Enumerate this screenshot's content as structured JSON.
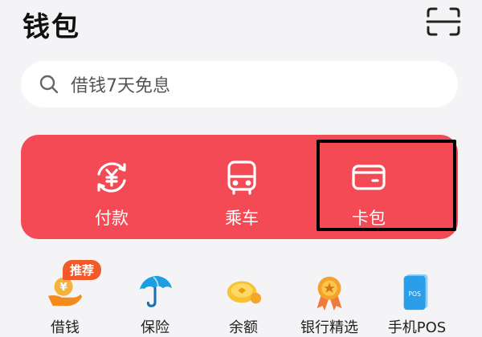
{
  "header": {
    "title": "钱包"
  },
  "search": {
    "text": "借钱7天免息"
  },
  "actions": [
    {
      "label": "付款",
      "icon": "payment-cycle-icon"
    },
    {
      "label": "乘车",
      "icon": "bus-icon"
    },
    {
      "label": "卡包",
      "icon": "card-wallet-icon"
    }
  ],
  "services": [
    {
      "label": "借钱",
      "icon": "yuan-hand-icon",
      "badge": "推荐"
    },
    {
      "label": "保险",
      "icon": "umbrella-icon"
    },
    {
      "label": "余额",
      "icon": "coin-icon"
    },
    {
      "label": "银行精选",
      "icon": "medal-icon"
    },
    {
      "label": "手机POS",
      "icon": "pos-terminal-icon",
      "icon_text": "POS"
    }
  ],
  "colors": {
    "background": "#f4f4f6",
    "card_red": "#f34a55",
    "badge": "#f25a2a"
  }
}
